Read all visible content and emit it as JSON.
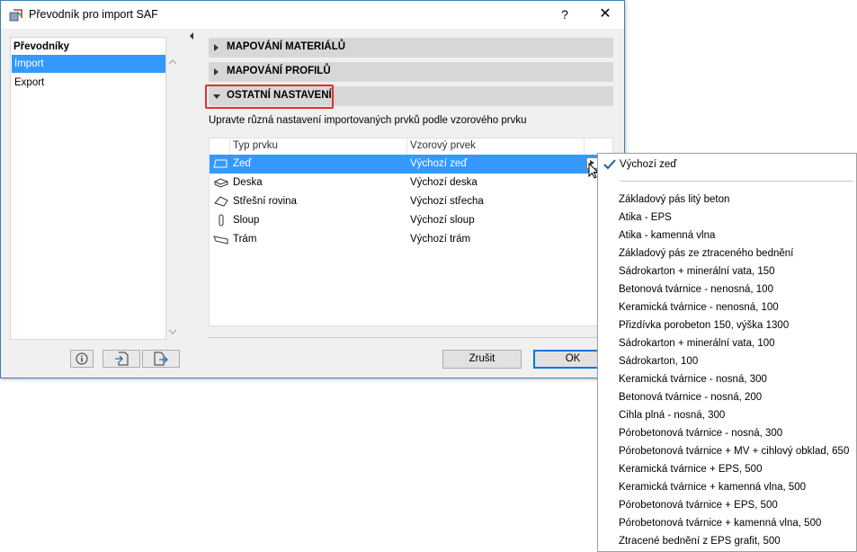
{
  "window": {
    "title": "Převodník pro import SAF",
    "help_label": "?",
    "close_label": "✕"
  },
  "left_panel": {
    "header": "Převodníky",
    "items": [
      {
        "label": "Import",
        "selected": true
      },
      {
        "label": "Export",
        "selected": false
      }
    ]
  },
  "sections": [
    {
      "label": "MAPOVÁNÍ MATERIÁLŮ",
      "expanded": false
    },
    {
      "label": "MAPOVÁNÍ PROFILŮ",
      "expanded": false
    },
    {
      "label": "OSTATNÍ NASTAVENÍ",
      "expanded": true
    }
  ],
  "description": "Upravte různá nastavení importovaných prvků podle vzorového prvku",
  "table": {
    "columns": [
      "Typ prvku",
      "Vzorový prvek"
    ],
    "rows": [
      {
        "icon": "wall-icon",
        "type": "Zeď",
        "sample": "Výchozí zeď",
        "selected": true
      },
      {
        "icon": "slab-icon",
        "type": "Deska",
        "sample": "Výchozí deska",
        "selected": false
      },
      {
        "icon": "roof-icon",
        "type": "Střešní rovina",
        "sample": "Výchozí střecha",
        "selected": false
      },
      {
        "icon": "column-icon",
        "type": "Sloup",
        "sample": "Výchozí sloup",
        "selected": false
      },
      {
        "icon": "beam-icon",
        "type": "Trám",
        "sample": "Výchozí trám",
        "selected": false
      }
    ]
  },
  "buttons": {
    "cancel": "Zrušit",
    "ok": "OK"
  },
  "popup": {
    "selected": "Výchozí zeď",
    "items": [
      "Základový pás litý beton",
      "Atika - EPS",
      "Atika - kamenná vlna",
      "Základový pás ze ztraceného bednění",
      "Sádrokarton + minerální vata, 150",
      "Betonová tvárnice - nenosná, 100",
      "Keramická tvárnice - nenosná, 100",
      "Přizdívka porobeton 150, výška 1300",
      "Sádrokarton + minerální vata, 100",
      "Sádrokarton, 100",
      "Keramická tvárnice - nosná, 300",
      "Betonová tvárnice - nosná, 200",
      "Cihla plná - nosná, 300",
      "Pórobetonová tvárnice - nosná, 300",
      "Pórobetonová tvárnice + MV + cihlový obklad, 650",
      "Keramická tvárnice + EPS, 500",
      "Keramická tvárnice + kamenná vlna, 500",
      "Pórobetonová tvárnice + EPS, 500",
      "Pórobetonová tvárnice + kamenná vlna, 500",
      "Ztracené bednění z EPS grafit, 500"
    ]
  },
  "colors": {
    "selection": "#3399ff",
    "highlight_box": "#e03030",
    "ok_border": "#0078d7"
  }
}
